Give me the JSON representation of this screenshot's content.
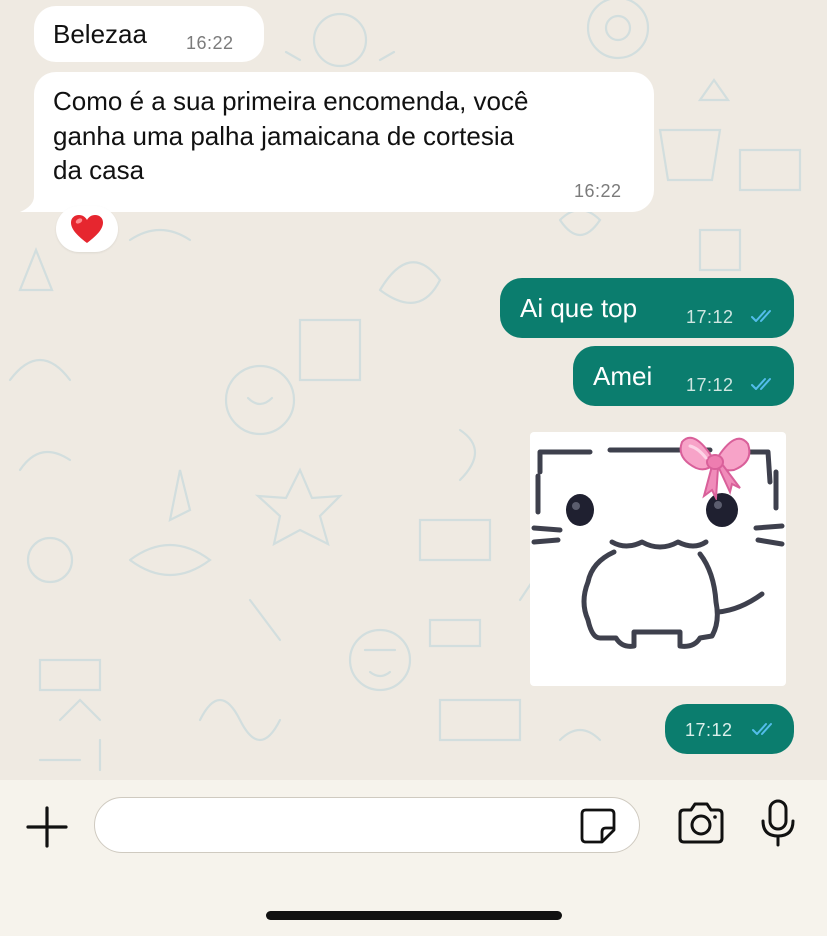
{
  "messages": [
    {
      "direction": "incoming",
      "text": "Belezaa",
      "time": "16:22"
    },
    {
      "direction": "incoming",
      "lines": [
        "Como é a sua primeira encomenda, você",
        "ganha uma palha jamaicana de cortesia",
        "da casa"
      ],
      "time": "16:22",
      "reaction": "❤️"
    },
    {
      "direction": "outgoing",
      "text": "Ai que top",
      "time": "17:12",
      "status": "read"
    },
    {
      "direction": "outgoing",
      "text": "Amei",
      "time": "17:12",
      "status": "read"
    },
    {
      "direction": "outgoing",
      "type": "sticker",
      "sticker": "white cat with pink bow",
      "time": "17:12",
      "status": "read"
    }
  ],
  "composer": {
    "placeholder": "",
    "value": ""
  },
  "colors": {
    "outgoing_bubble": "#0b7d6e",
    "incoming_bubble": "#ffffff",
    "read_ticks": "#53bdeb",
    "background": "#efeae2"
  },
  "icons": [
    "plus-icon",
    "sticker-icon",
    "camera-icon",
    "microphone-icon",
    "double-check-icon",
    "heart-emoji-icon",
    "bow-icon"
  ]
}
